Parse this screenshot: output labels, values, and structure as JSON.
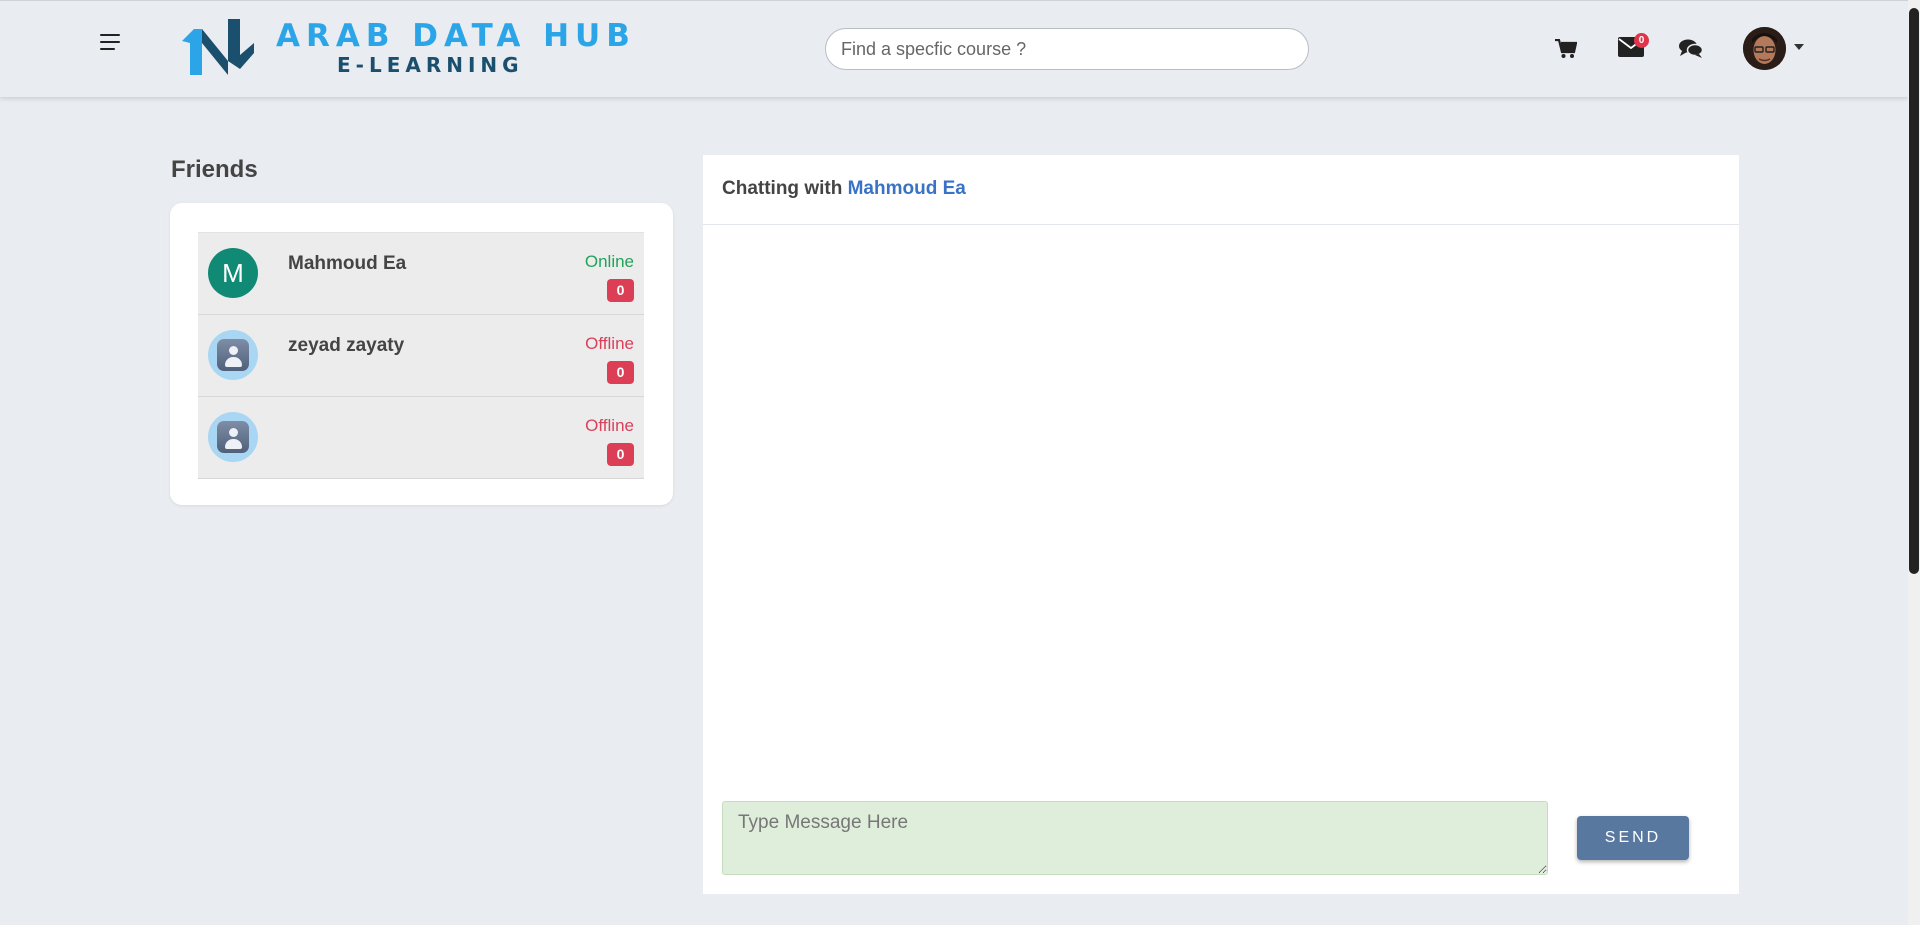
{
  "header": {
    "logo": {
      "title": "ARAB DATA HUB",
      "subtitle": "E-LEARNING"
    },
    "search": {
      "placeholder": "Find a specfic course ?",
      "value": ""
    },
    "icons": [
      "menu-icon",
      "cart-icon",
      "mail-icon",
      "chat-icon"
    ],
    "mail_badge": "0",
    "colors": {
      "logo_blue": "#2ba5e8",
      "logo_dark": "#1b4f6e",
      "badge_red": "#e0344a"
    }
  },
  "friends": {
    "title": "Friends",
    "items": [
      {
        "initial": "M",
        "name": "Mahmoud Ea",
        "status": "Online",
        "unread": "0",
        "avatar": "letter"
      },
      {
        "initial": "",
        "name": "zeyad zayaty",
        "status": "Offline",
        "unread": "0",
        "avatar": "generic-user-icon"
      },
      {
        "initial": "",
        "name": "",
        "status": "Offline",
        "unread": "0",
        "avatar": "generic-user-icon"
      }
    ],
    "colors": {
      "online": "#22a35a",
      "offline": "#d9415a",
      "avatar_green": "#118a75"
    }
  },
  "chat": {
    "header_prefix": "Chatting with",
    "partner": "Mahmoud Ea",
    "input": {
      "placeholder": "Type Message Here",
      "value": ""
    },
    "send_label": "SEND",
    "colors": {
      "partner": "#3a72c6",
      "input_bg": "#dfeedb",
      "send_bg": "#59789f"
    }
  }
}
